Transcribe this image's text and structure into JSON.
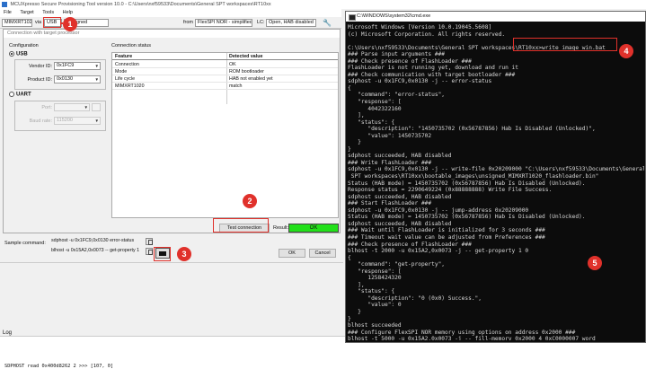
{
  "main_window": {
    "title": "MCUXpresso Secure Provisioning Tool version 10.0 - C:\\Users\\nxf59533\\Documents\\General SPT workspaces\\RT10xx",
    "menu": [
      "File",
      "Target",
      "Tools",
      "Help"
    ]
  },
  "toolbar": {
    "device": "MIMXRT1020",
    "via_label": "via",
    "connection": "USB",
    "boot_type": "Unsigned",
    "from_label": "from",
    "boot_memory": "FlexSPI NOR - simplified",
    "lc_label": "LC:",
    "lifecycle": "Open, HAB disabled"
  },
  "dialog": {
    "title": "Connection with target processor",
    "configuration_label": "Configuration",
    "usb_label": "USB",
    "vendor_id_label": "Vendor ID:",
    "vendor_id": "0x1FC9",
    "product_id_label": "Product ID:",
    "product_id": "0x0130",
    "uart_label": "UART",
    "port_label": "Port:",
    "baud_label": "Baud rate:",
    "baud_rate": "115200",
    "status_label": "Connection status",
    "status_headers": [
      "Feature",
      "Detected value"
    ],
    "status_rows": [
      [
        "Connection",
        "OK"
      ],
      [
        "Mode",
        "ROM bootloader"
      ],
      [
        "Life cycle",
        "HAB not enabled yet"
      ],
      [
        "MIMXRT1020",
        "match"
      ]
    ],
    "test_button": "Test connection",
    "result_label": "Result:",
    "result_value": "OK",
    "sample_command_label": "Sample command:",
    "sample_commands": [
      "sdphost -u 0x1FC9,0x0130 error-status",
      "blhost -u 0x15A2,0x0073 -- get-property 1"
    ],
    "ok_button": "OK",
    "cancel_button": "Cancel"
  },
  "log": {
    "label": "Log",
    "line": "SDPHOST read 0x400d8262 2 >>> [107, 0]"
  },
  "cmd": {
    "title": "C:\\WINDOWS\\system32\\cmd.exe",
    "lines": [
      "Microsoft Windows [Version 10.0.19045.5608]",
      "(c) Microsoft Corporation. All rights reserved.",
      "",
      "C:\\Users\\nxf59533\\Documents\\General SPT workspaces\\RT10xx>write_image_win.bat",
      "### Parse input arguments ###",
      "### Check presence of FlashLoader ###",
      "FlashLoader is not running yet, download and run it",
      "### Check communication with target bootloader ###",
      "sdphost -u 0x1FC9,0x0130 -j -- error-status",
      "{",
      "   \"command\": \"error-status\",",
      "   \"response\": [",
      "      4042322160",
      "   ],",
      "   \"status\": {",
      "      \"description\": \"1450735702 (0x56787856) Hab Is Disabled (Unlocked)\",",
      "      \"value\": 1450735702",
      "   }",
      "}",
      "sdphost succeeded, HAB disabled",
      "### Write FlashLoader ###",
      "sdphost -u 0x1FC9,0x0130 -j -- write-file 0x20209000 \"C:\\Users\\nxf59533\\Documents\\General",
      " SPT workspaces\\RT10xx\\bootable_images\\unsigned_MIMXRT1020_flashloader.bin\"",
      "Status (HAB mode) = 1450735702 (0x56787856) Hab Is Disabled (Unlocked).",
      "Response status = 2290649224 (0x88888888) Write File Success.",
      "sdphost succeeded, HAB disabled",
      "### Start FlashLoader ###",
      "sdphost -u 0x1FC9,0x0130 -j -- jump-address 0x20209000",
      "Status (HAB mode) = 1450735702 (0x56787856) Hab Is Disabled (Unlocked).",
      "sdphost succeeded, HAB disabled",
      "### Wait until FlashLoader is initialized for 3 seconds ###",
      "### Timeout wait value can be adjusted from Preferences ###",
      "### Check presence of FlashLoader ###",
      "blhost -t 2000 -u 0x15A2,0x0073 -j -- get-property 1 0",
      "{",
      "   \"command\": \"get-property\",",
      "   \"response\": [",
      "      1258424320",
      "   ],",
      "   \"status\": {",
      "      \"description\": \"0 (0x0) Success.\",",
      "      \"value\": 0",
      "   }",
      "}",
      "blhost succeeded",
      "### Configure FlexSPI NOR memory using options on address 0x2000 ###",
      "blhost -t 5000 -u 0x15A2,0x0073 -j -- fill-memory 0x2000 4 0xC0000007 word"
    ]
  },
  "annotations": [
    "1",
    "2",
    "3",
    "4",
    "5"
  ],
  "colors": {
    "annotation": "#e0312b",
    "result_ok": "#22e01a",
    "console_bg": "#0c0c0c"
  }
}
